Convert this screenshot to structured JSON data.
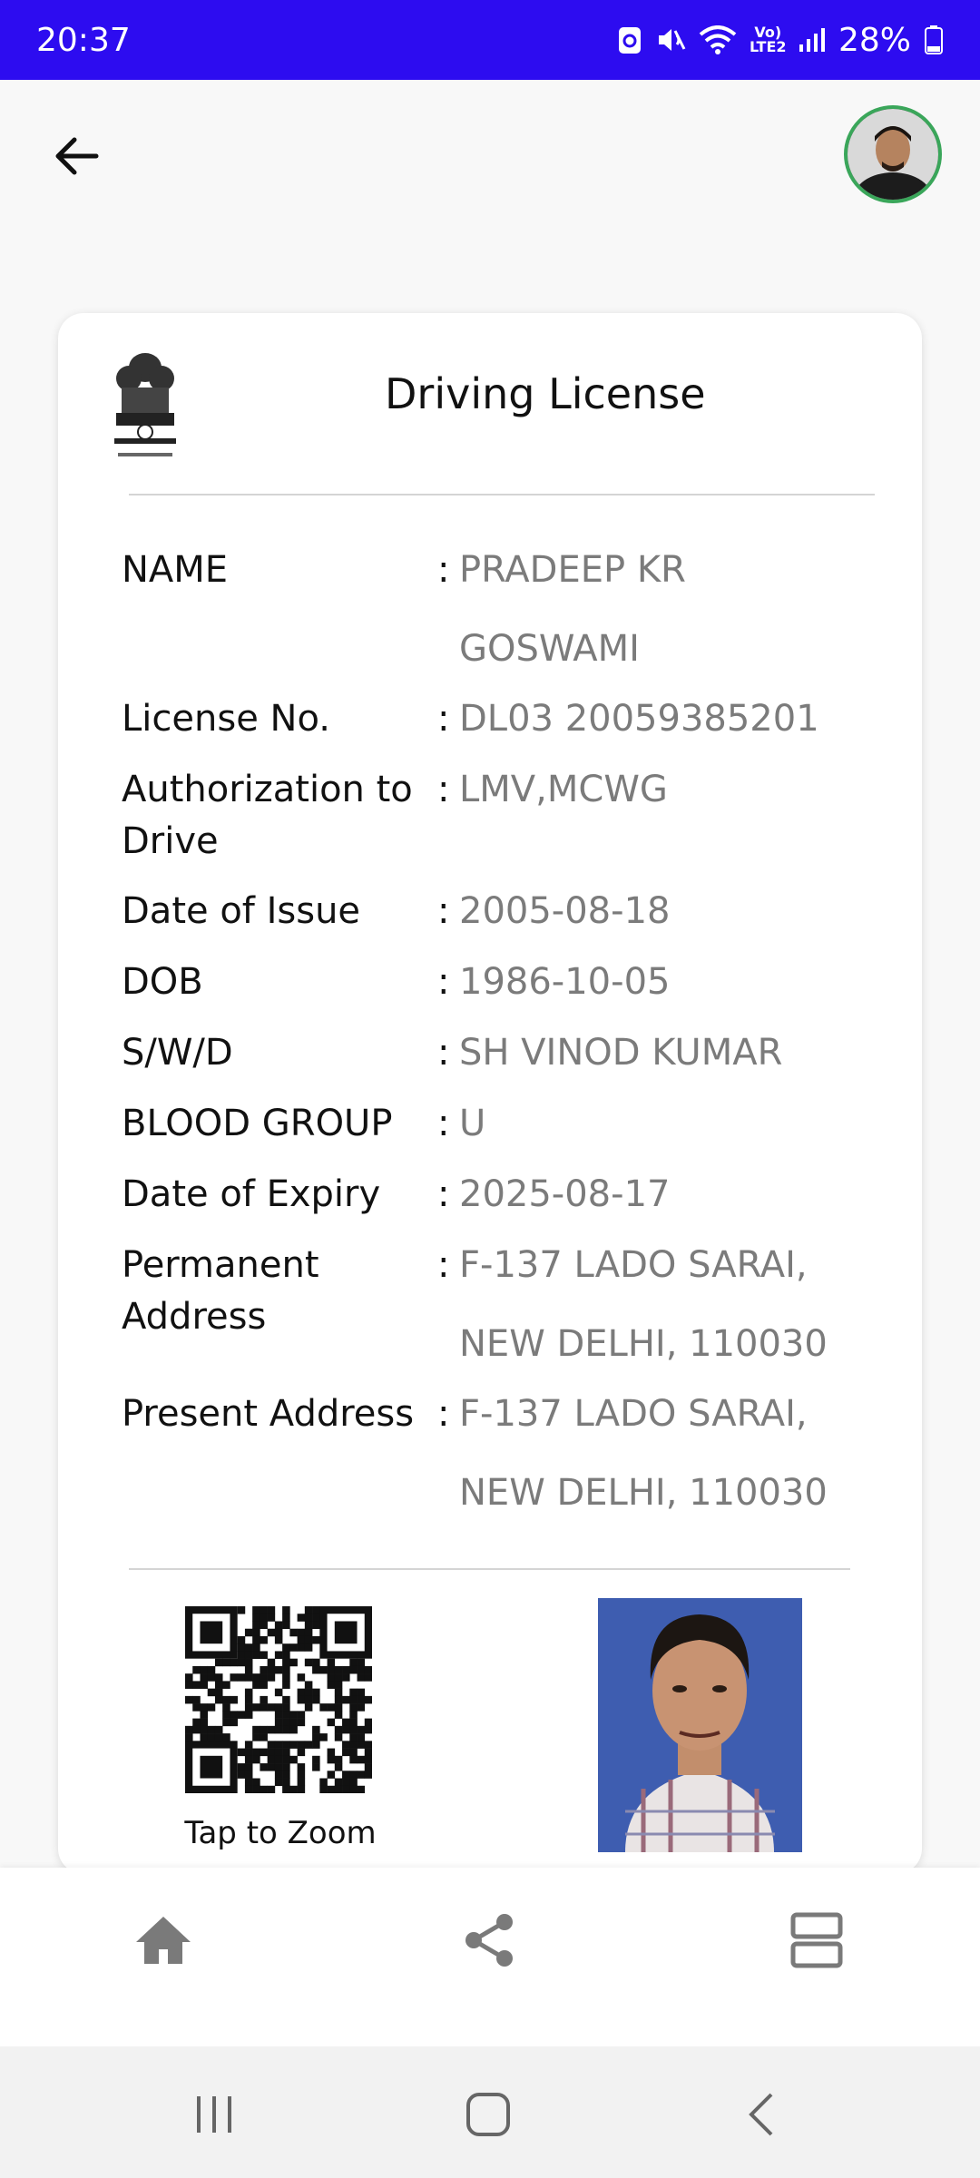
{
  "status_bar": {
    "time": "20:37",
    "network": "Vo) LTE2",
    "battery": "28%"
  },
  "app_bar": {
    "back_icon": "arrow-left-icon",
    "avatar": "profile-avatar"
  },
  "card": {
    "title": "Driving License",
    "emblem_icon": "national-emblem-icon",
    "fields": [
      {
        "label": "NAME",
        "value": "PRADEEP KR GOSWAMI"
      },
      {
        "label": "License No.",
        "value": "DL03 20059385201"
      },
      {
        "label": "Authorization to Drive",
        "value": "LMV,MCWG"
      },
      {
        "label": "Date of Issue",
        "value": "2005-08-18"
      },
      {
        "label": "DOB",
        "value": "1986-10-05"
      },
      {
        "label": "S/W/D",
        "value": "SH VINOD KUMAR"
      },
      {
        "label": "BLOOD GROUP",
        "value": "U"
      },
      {
        "label": "Date of Expiry",
        "value": "2025-08-17"
      },
      {
        "label": "Permanent Address",
        "value": "F-137 LADO SARAI, NEW DELHI, 110030"
      },
      {
        "label": "Present Address",
        "value": "F-137 LADO SARAI, NEW DELHI, 110030"
      }
    ],
    "colon": ":",
    "qr_caption": "Tap to Zoom"
  },
  "bottom_nav": {
    "icons": [
      "home-icon",
      "share-icon",
      "list-view-icon"
    ]
  },
  "system_nav": {
    "icons": [
      "recents-icon",
      "home-circle-icon",
      "back-chevron-icon"
    ]
  },
  "colors": {
    "status_bar": "#2d0cf0",
    "value_text": "#7b7b7b",
    "nav_icon": "#7a7a7a"
  }
}
